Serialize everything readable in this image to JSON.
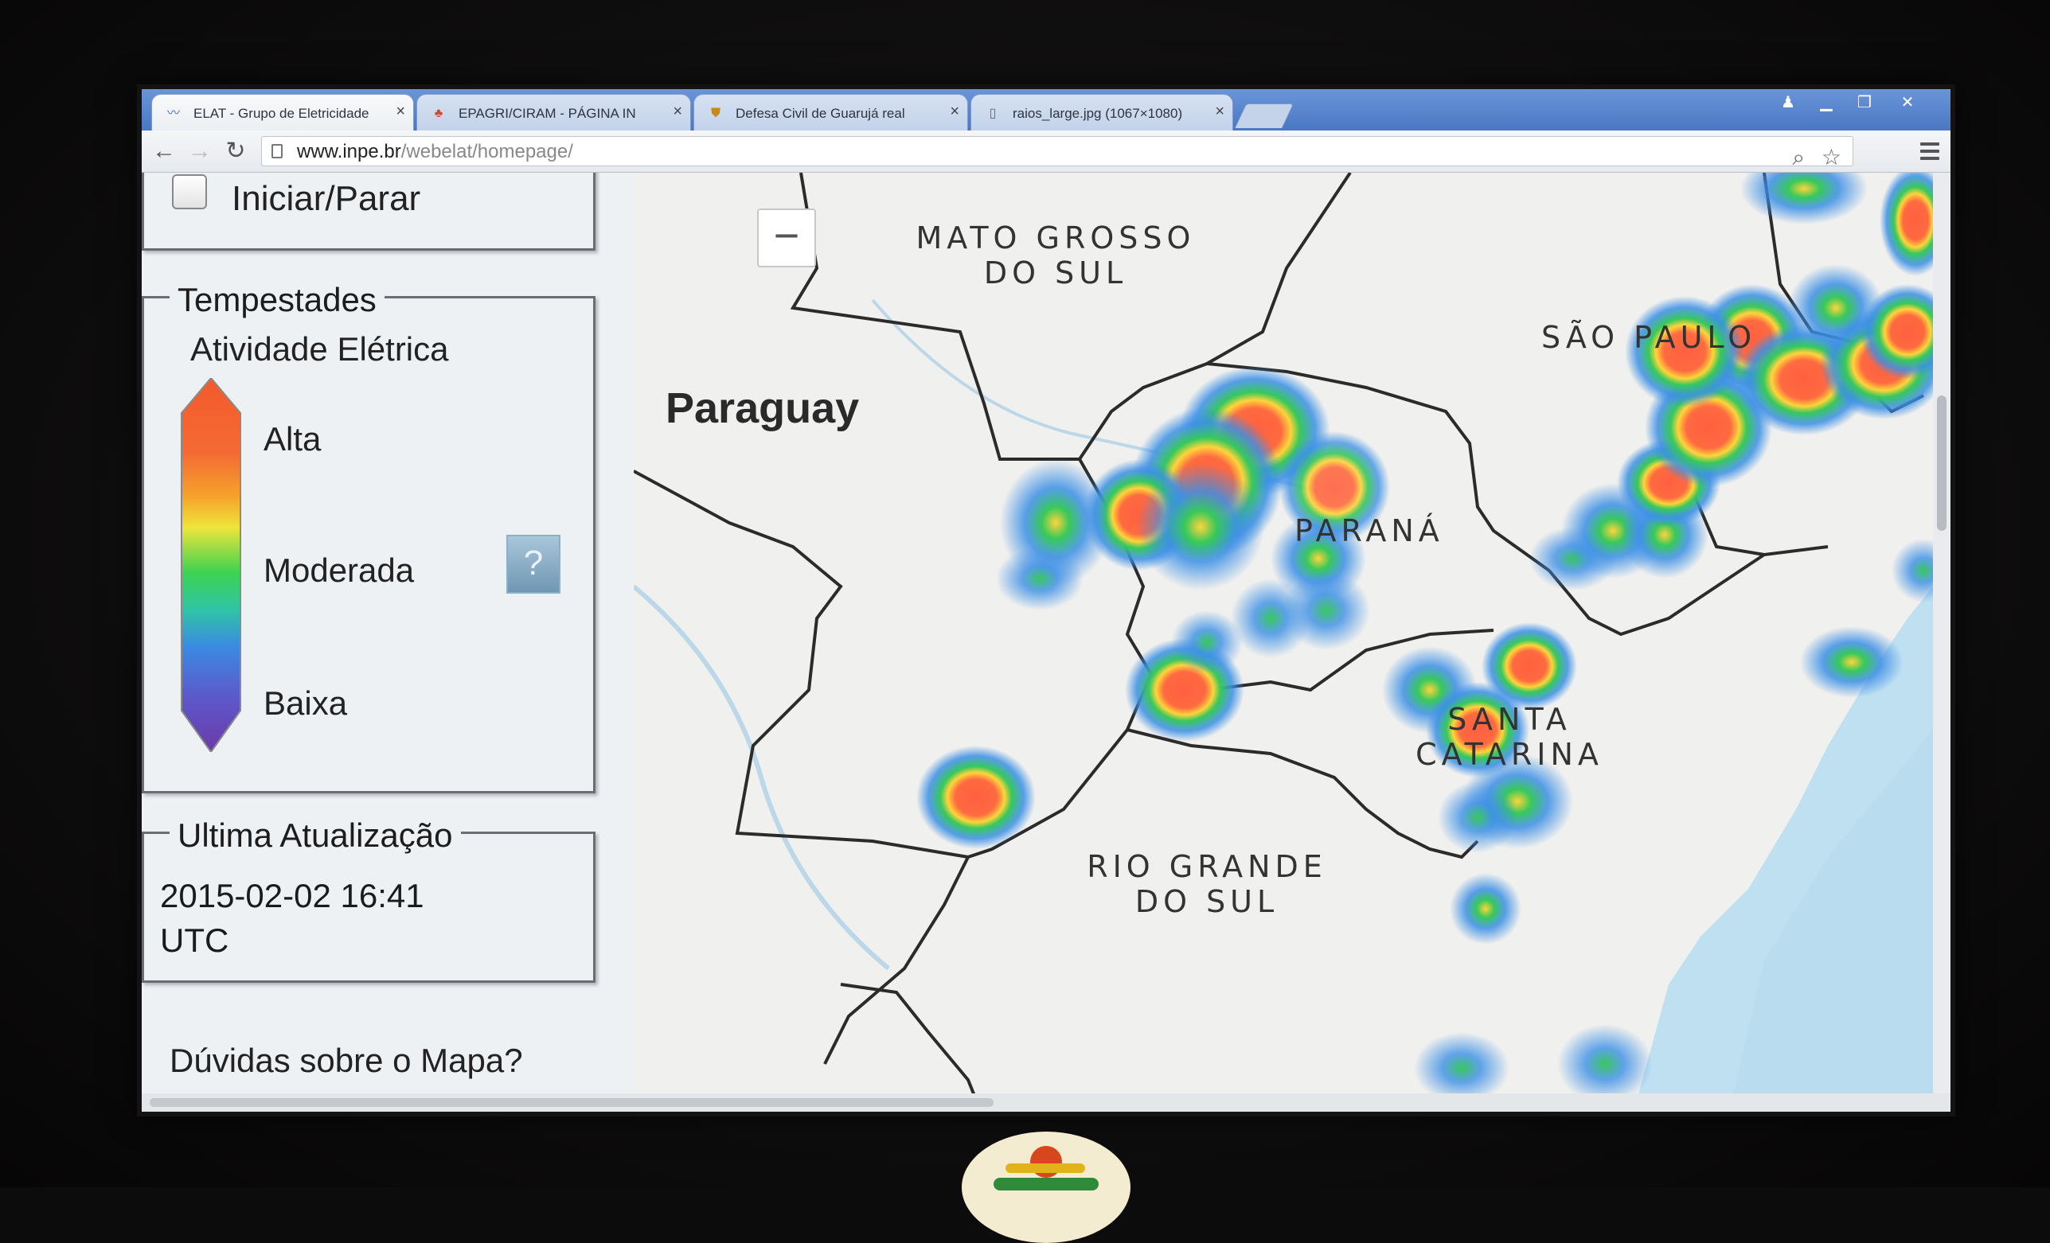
{
  "browser": {
    "tabs": [
      {
        "label": "ELAT - Grupo de Eletricidade",
        "icon": "bird-favicon-icon",
        "active": true
      },
      {
        "label": "EPAGRI/CIRAM - PÁGINA IN",
        "icon": "epagri-favicon-icon",
        "active": false
      },
      {
        "label": "Defesa Civil de Guarujá real",
        "icon": "shield-favicon-icon",
        "active": false
      },
      {
        "label": "raios_large.jpg (1067×1080)",
        "icon": "document-favicon-icon",
        "active": false
      }
    ],
    "url_host": "www.inpe.br",
    "url_path": "/webelat/homepage/"
  },
  "sidebar": {
    "start_label": "Iniciar/Parar",
    "storms_legend": "Tempestades",
    "storms_subtitle": "Atividade Elétrica",
    "scale_high": "Alta",
    "scale_mid": "Moderada",
    "scale_low": "Baixa",
    "help_button": "?",
    "update_legend": "Ultima Atualização",
    "update_date": "2015-02-02 16:41",
    "update_tz": "UTC",
    "map_help_link": "Dúvidas sobre o Mapa?"
  },
  "map": {
    "zoom_out": "−",
    "labels": {
      "paraguay": "Paraguay",
      "mato_grosso_do_sul_1": "MATO GROSSO",
      "mato_grosso_do_sul_2": "DO SUL",
      "sao_paulo": "SÃO PAULO",
      "parana": "PARANÁ",
      "santa_catarina_1": "SANTA",
      "santa_catarina_2": "CATARINA",
      "rio_grande_do_sul_1": "RIO GRANDE",
      "rio_grande_do_sul_2": "DO SUL"
    },
    "heat_colors": {
      "high": "#ff6040",
      "mid_high": "#ffd43a",
      "mid": "#37c95a",
      "low": "#3b8fe6"
    },
    "ocean_color": "#bfe0f1",
    "land_color": "#f0f0ee"
  }
}
